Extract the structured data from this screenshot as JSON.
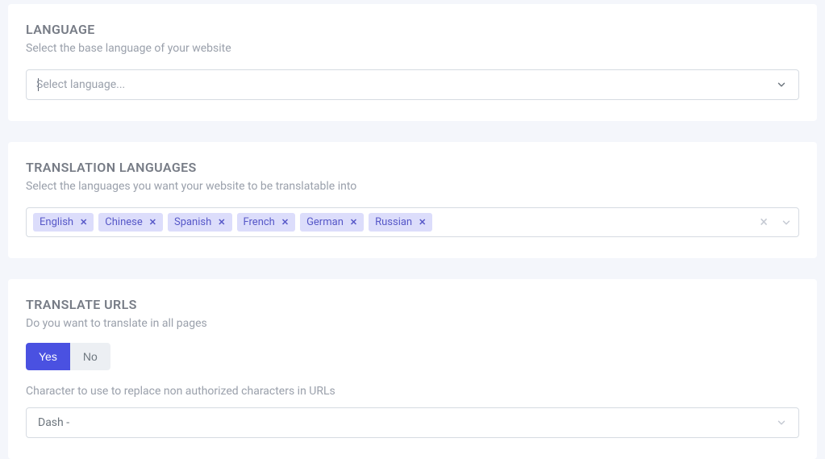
{
  "language": {
    "title": "LANGUAGE",
    "description": "Select the base language of your website",
    "placeholder": "Select language..."
  },
  "translation": {
    "title": "TRANSLATION LANGUAGES",
    "description": "Select the languages you want your website to be translatable into",
    "tags": [
      {
        "label": "English"
      },
      {
        "label": "Chinese"
      },
      {
        "label": "Spanish"
      },
      {
        "label": "French"
      },
      {
        "label": "German"
      },
      {
        "label": "Russian"
      }
    ],
    "remove_symbol": "✕"
  },
  "urls": {
    "title": "TRANSLATE URLS",
    "description": "Do you want to translate in all pages",
    "toggle": {
      "yes": "Yes",
      "no": "No"
    },
    "char_label": "Character to use to replace non authorized characters in URLs",
    "char_value": "Dash -"
  }
}
